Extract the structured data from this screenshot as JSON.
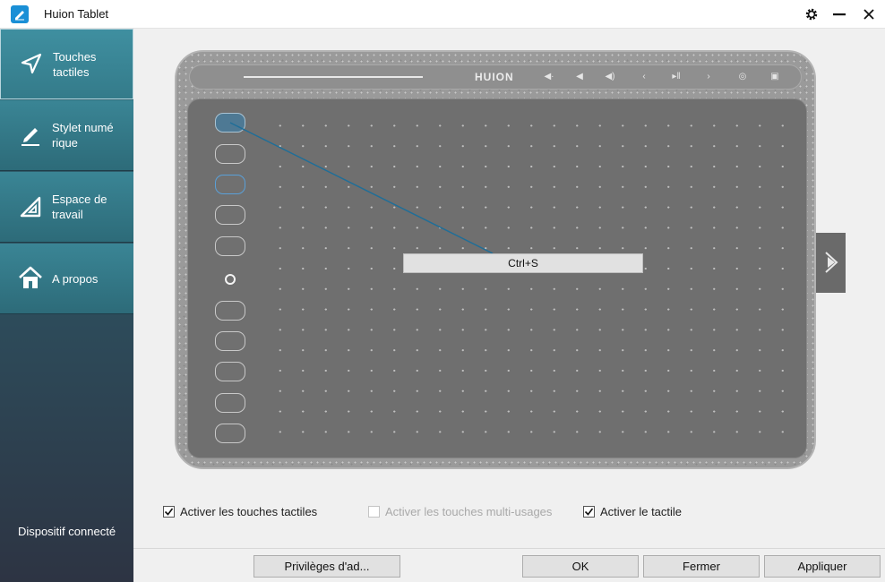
{
  "window": {
    "title": "Huion Tablet"
  },
  "sidebar": {
    "items": [
      {
        "label": "Touches tactiles",
        "icon": "navigation-arrow-icon",
        "active": true
      },
      {
        "label": "Stylet numé rique",
        "icon": "pen-icon",
        "active": false
      },
      {
        "label": "Espace de travail",
        "icon": "set-square-icon",
        "active": false
      },
      {
        "label": "A propos",
        "icon": "home-icon",
        "active": false
      }
    ],
    "device_status": "Dispositif connecté"
  },
  "tablet": {
    "brand": "HUION",
    "selected_key_assignment": "Ctrl+S"
  },
  "options": {
    "enable_express_keys": {
      "label": "Activer les touches tactiles",
      "checked": true,
      "enabled": true
    },
    "enable_multifunction_keys": {
      "label": "Activer les touches multi-usages",
      "checked": false,
      "enabled": false
    },
    "enable_touch": {
      "label": "Activer le tactile",
      "checked": true,
      "enabled": true
    }
  },
  "footer": {
    "admin_label": "Privilèges d'ad...",
    "ok_label": "OK",
    "close_label": "Fermer",
    "apply_label": "Appliquer"
  },
  "colors": {
    "sidebar_top": "#3a8595",
    "sidebar_bottom": "#2d3443",
    "accent_line": "#1f6e98"
  }
}
